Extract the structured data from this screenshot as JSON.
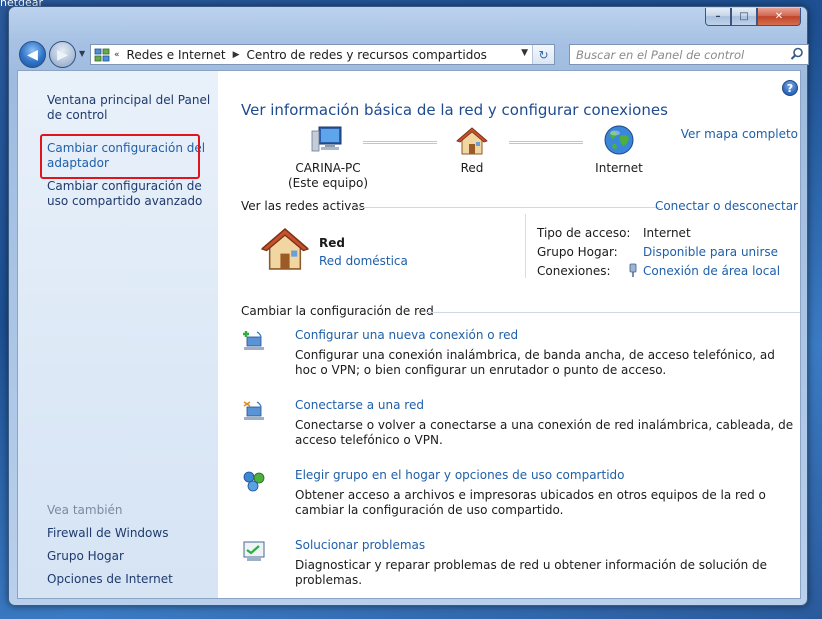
{
  "desktop": {
    "label": "netgear"
  },
  "window": {
    "min": "–",
    "max": "□",
    "close": "✕"
  },
  "toolbar": {
    "back_glyph": "◀",
    "forward_glyph": "▶",
    "breadcrumb_lead": "«",
    "breadcrumbs": [
      "Redes e Internet",
      "Centro de redes y recursos compartidos"
    ],
    "breadcrumb_sep": "▶",
    "dropdown_glyph": "▼",
    "refresh_glyph": "↻",
    "search_placeholder": "Buscar en el Panel de control"
  },
  "sidebar": {
    "items": [
      {
        "label": "Ventana principal del Panel de control"
      },
      {
        "label": "Cambiar configuración del adaptador"
      },
      {
        "label": "Cambiar configuración de uso compartido avanzado"
      }
    ],
    "see_also_label": "Vea también",
    "see_also": [
      {
        "label": "Firewall de Windows"
      },
      {
        "label": "Grupo Hogar"
      },
      {
        "label": "Opciones de Internet"
      }
    ]
  },
  "main": {
    "help": "?",
    "title": "Ver información básica de la red y configurar conexiones",
    "map_link": "Ver mapa completo",
    "nodes": [
      {
        "line1": "CARINA-PC",
        "line2": "(Este equipo)",
        "icon": "computer-icon"
      },
      {
        "line1": "Red",
        "line2": "",
        "icon": "house-icon"
      },
      {
        "line1": "Internet",
        "line2": "",
        "icon": "globe-icon"
      }
    ],
    "active_networks_label": "Ver las redes activas",
    "connect_link": "Conectar o desconectar",
    "network": {
      "name": "Red",
      "type": "Red doméstica"
    },
    "properties": [
      {
        "label": "Tipo de acceso:",
        "value": "Internet",
        "is_link": false
      },
      {
        "label": "Grupo Hogar:",
        "value": "Disponible para unirse",
        "is_link": true
      },
      {
        "label": "Conexiones:",
        "value": "Conexión de área local",
        "is_link": true
      }
    ],
    "change_settings_label": "Cambiar la configuración de red",
    "tasks": [
      {
        "title": "Configurar una nueva conexión o red",
        "desc": "Configurar una conexión inalámbrica, de banda ancha, de acceso telefónico, ad hoc o VPN; o bien configurar un enrutador o punto de acceso."
      },
      {
        "title": "Conectarse a una red",
        "desc": "Conectarse o volver a conectarse a una conexión de red inalámbrica, cableada, de acceso telefónico o VPN."
      },
      {
        "title": "Elegir grupo en el hogar y opciones de uso compartido",
        "desc": "Obtener acceso a archivos e impresoras ubicados en otros equipos de la red o cambiar la configuración de uso compartido."
      },
      {
        "title": "Solucionar problemas",
        "desc": "Diagnosticar y reparar problemas de red u obtener información de solución de problemas."
      }
    ]
  },
  "colors": {
    "link": "#1f5fa8",
    "title": "#1e4b8f",
    "highlight": "#e0141d"
  }
}
